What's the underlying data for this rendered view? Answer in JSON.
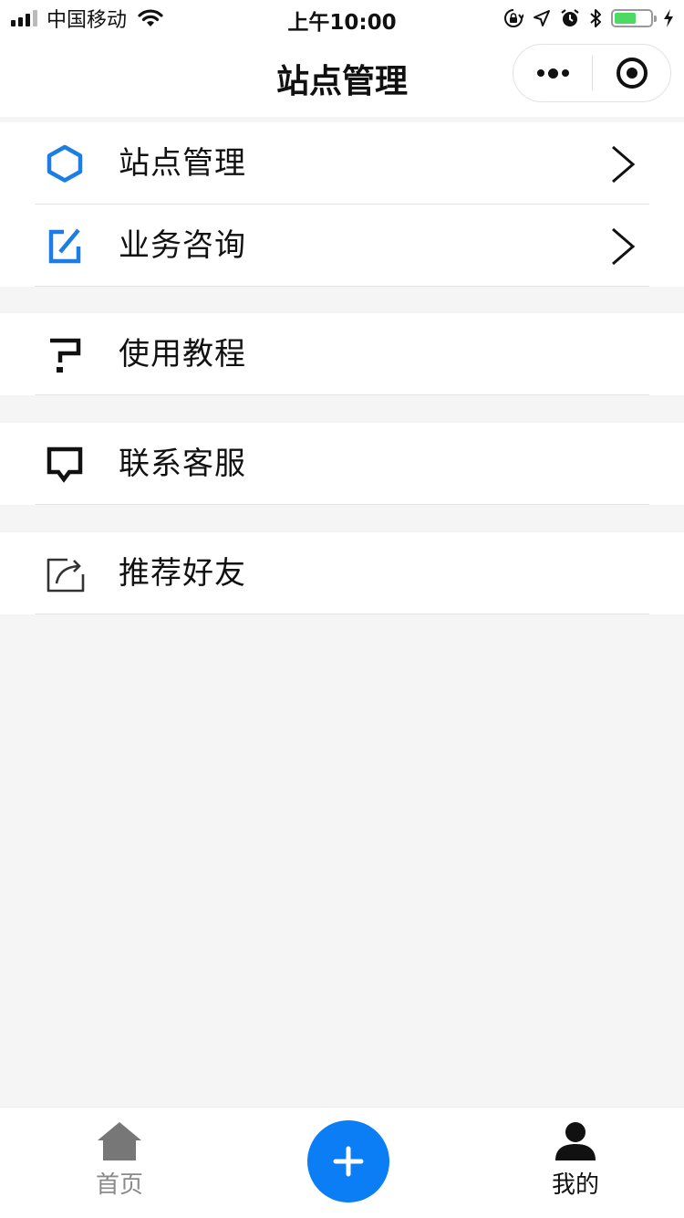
{
  "status_bar": {
    "carrier": "中国移动",
    "time": "上午10:00",
    "battery_color": "#4cd964",
    "battery_level": 0.6
  },
  "nav": {
    "title": "站点管理",
    "more_icon": "more-dots-icon",
    "close_icon": "target-circle-icon"
  },
  "groups": [
    {
      "items": [
        {
          "label": "站点管理",
          "icon": "hexagon-icon",
          "icon_color": "#1a7ee6",
          "arrow": true
        },
        {
          "label": "业务咨询",
          "icon": "edit-square-icon",
          "icon_color": "#1a7ee6",
          "arrow": true
        }
      ]
    },
    {
      "items": [
        {
          "label": "使用教程",
          "icon": "question-icon",
          "icon_color": "#111111",
          "arrow": false
        }
      ]
    },
    {
      "items": [
        {
          "label": "联系客服",
          "icon": "chat-bubble-icon",
          "icon_color": "#111111",
          "arrow": false
        }
      ]
    },
    {
      "items": [
        {
          "label": "推荐好友",
          "icon": "share-icon",
          "icon_color": "#333333",
          "arrow": false
        }
      ]
    }
  ],
  "tab_bar": {
    "home_label": "首页",
    "mine_label": "我的",
    "fab_color": "#0c7ef5",
    "home_color": "#777777",
    "mine_color": "#111111"
  }
}
